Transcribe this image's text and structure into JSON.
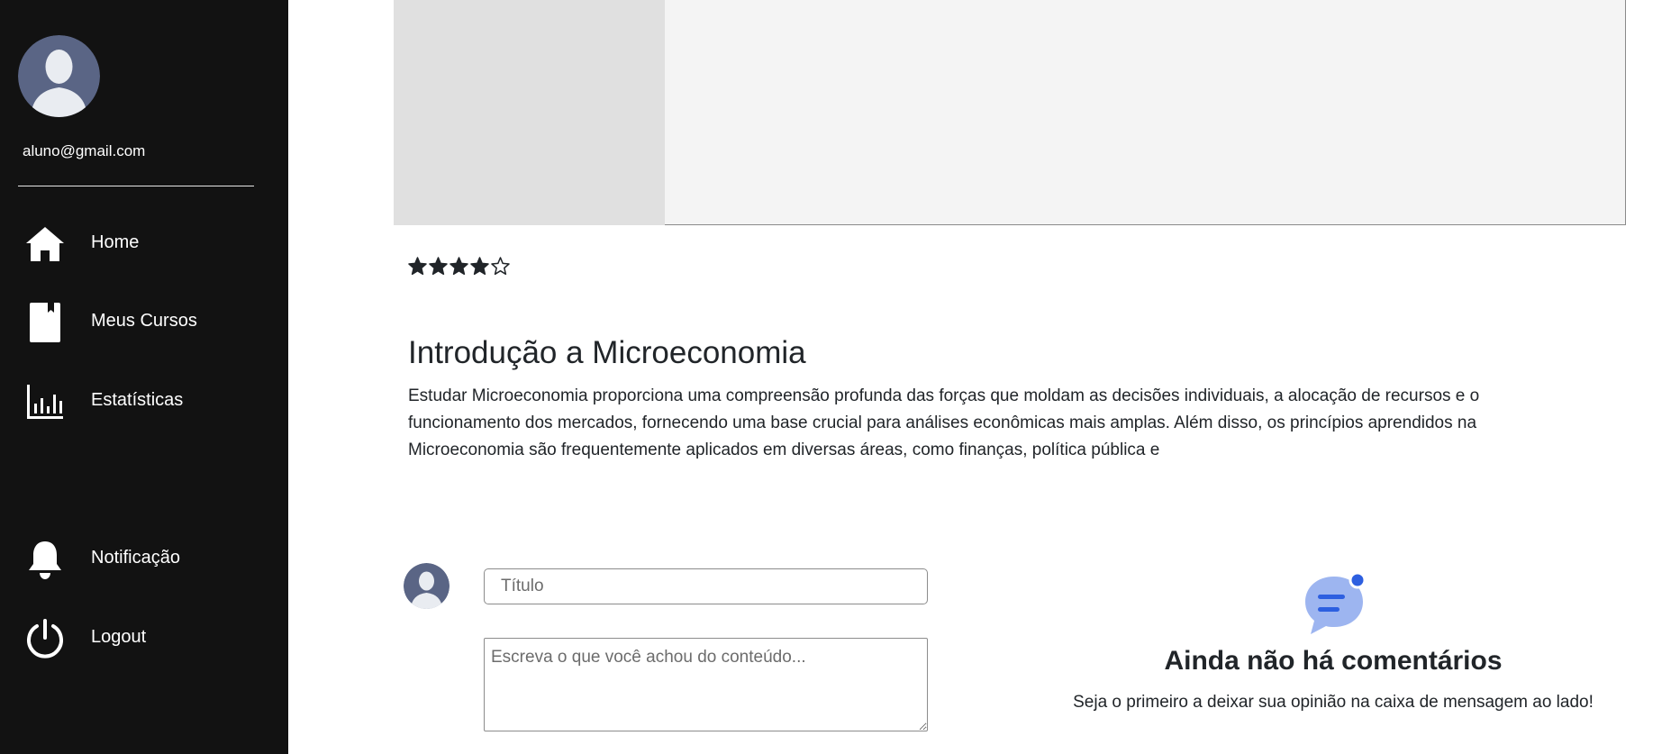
{
  "sidebar": {
    "user_email": "aluno@gmail.com",
    "nav_items": [
      {
        "label": "Home",
        "icon": "home-icon"
      },
      {
        "label": "Meus Cursos",
        "icon": "book-icon"
      },
      {
        "label": "Estatísticas",
        "icon": "bar-chart-icon"
      },
      {
        "label": "Notificação",
        "icon": "bell-icon"
      },
      {
        "label": "Logout",
        "icon": "power-icon"
      }
    ]
  },
  "course": {
    "rating": 4,
    "rating_max": 5,
    "title": "Introdução a Microeconomia",
    "description": "Estudar Microeconomia proporciona uma compreensão profunda das forças que moldam as decisões individuais, a alocação de recursos e o funcionamento dos mercados, fornecendo uma base crucial para análises econômicas mais amplas. Além disso, os princípios aprendidos na Microeconomia são frequentemente aplicados em diversas áreas, como finanças, política pública e"
  },
  "comment_form": {
    "title_placeholder": "Título",
    "title_value": "",
    "body_placeholder": "Escreva o que você achou do conteúdo...",
    "body_value": ""
  },
  "comments_empty": {
    "icon": "chat-bubble-icon",
    "title": "Ainda não há comentários",
    "subtitle": "Seja o primeiro a deixar sua opinião na caixa de mensagem ao lado!"
  },
  "colors": {
    "sidebar_bg": "#121212",
    "avatar_bg": "#5a6585",
    "chat_icon_fill": "#9db5f0",
    "chat_icon_accent": "#2d5fe0"
  }
}
